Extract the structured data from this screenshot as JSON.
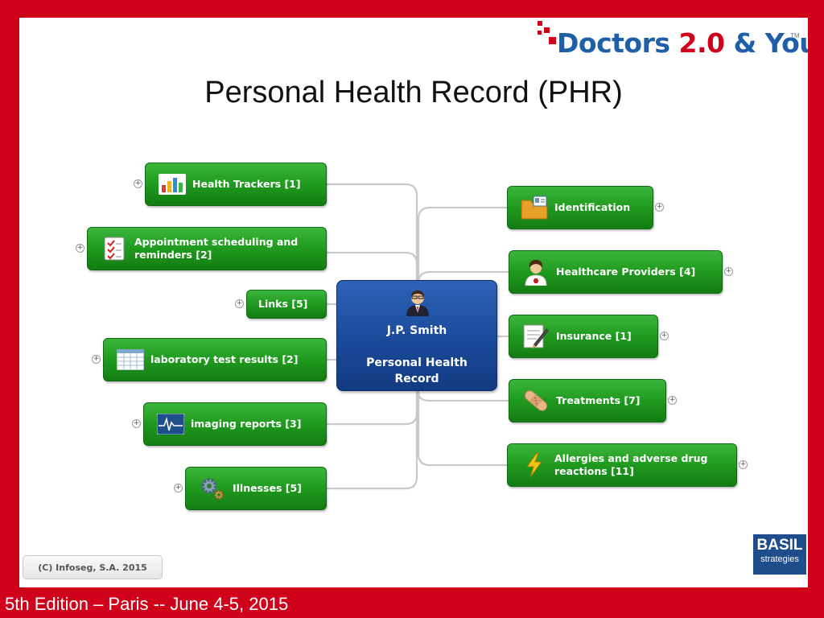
{
  "logo": {
    "text_part1": "Doctors ",
    "text_part2": "2.0",
    "text_part3": " & You",
    "tm": "TM"
  },
  "title": "Personal Health Record (PHR)",
  "center": {
    "name": "J.P. Smith",
    "record": "Personal Health Record"
  },
  "left_nodes": [
    {
      "label": "Health Trackers [1]",
      "icon": "bar-chart-icon"
    },
    {
      "label": "Appointment scheduling and reminders [2]",
      "icon": "checklist-icon"
    },
    {
      "label": "Links [5]",
      "icon": ""
    },
    {
      "label": "laboratory test results [2]",
      "icon": "spreadsheet-icon"
    },
    {
      "label": "imaging reports [3]",
      "icon": "ecg-monitor-icon"
    },
    {
      "label": "Illnesses [5]",
      "icon": "gears-icon"
    }
  ],
  "right_nodes": [
    {
      "label": "Identification",
      "icon": "id-folder-icon"
    },
    {
      "label": "Healthcare Providers [4]",
      "icon": "nurse-icon"
    },
    {
      "label": "Insurance [1]",
      "icon": "document-pen-icon"
    },
    {
      "label": "Treatments [7]",
      "icon": "bandage-icon"
    },
    {
      "label": "Allergies and adverse drug reactions [11]",
      "icon": "lightning-icon"
    }
  ],
  "expand_symbol": "+",
  "copyright": "(C) Infoseg, S.A. 2015",
  "basil": {
    "line1": "BASIL",
    "line2": "strategies"
  },
  "footer": "5th Edition – Paris -- June 4-5, 2015",
  "colors": {
    "frame": "#d0021b",
    "node_green": "#1f9a1f",
    "center_blue": "#1a4a9a",
    "logo_blue": "#1f5fa8",
    "basil_blue": "#1f4d8c"
  }
}
